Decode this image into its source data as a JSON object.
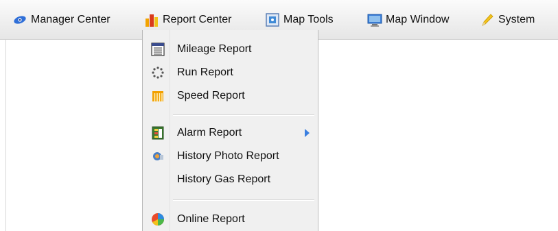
{
  "menubar": {
    "items": [
      {
        "label": "Manager Center",
        "icon": "eye-icon"
      },
      {
        "label": "Report Center",
        "icon": "bar-chart-icon"
      },
      {
        "label": "Map Tools",
        "icon": "map-tools-icon"
      },
      {
        "label": "Map Window",
        "icon": "monitor-icon"
      },
      {
        "label": "System",
        "icon": "pencil-icon"
      }
    ]
  },
  "report_menu": {
    "items": [
      {
        "label": "Mileage Report",
        "icon": "calendar-list-icon"
      },
      {
        "label": "Run Report",
        "icon": "dotted-circle-icon"
      },
      {
        "label": "Speed Report",
        "icon": "speed-bars-icon"
      },
      {
        "label": "Alarm Report",
        "icon": "alarm-report-icon",
        "submenu": true
      },
      {
        "label": "History Photo Report",
        "icon": "photo-icon"
      },
      {
        "label": "History Gas Report",
        "icon": ""
      },
      {
        "label": "Online Report",
        "icon": "online-globe-icon"
      }
    ]
  },
  "colors": {
    "submenu_arrow": "#3a7fe0",
    "menu_background": "#f0f0f0"
  }
}
